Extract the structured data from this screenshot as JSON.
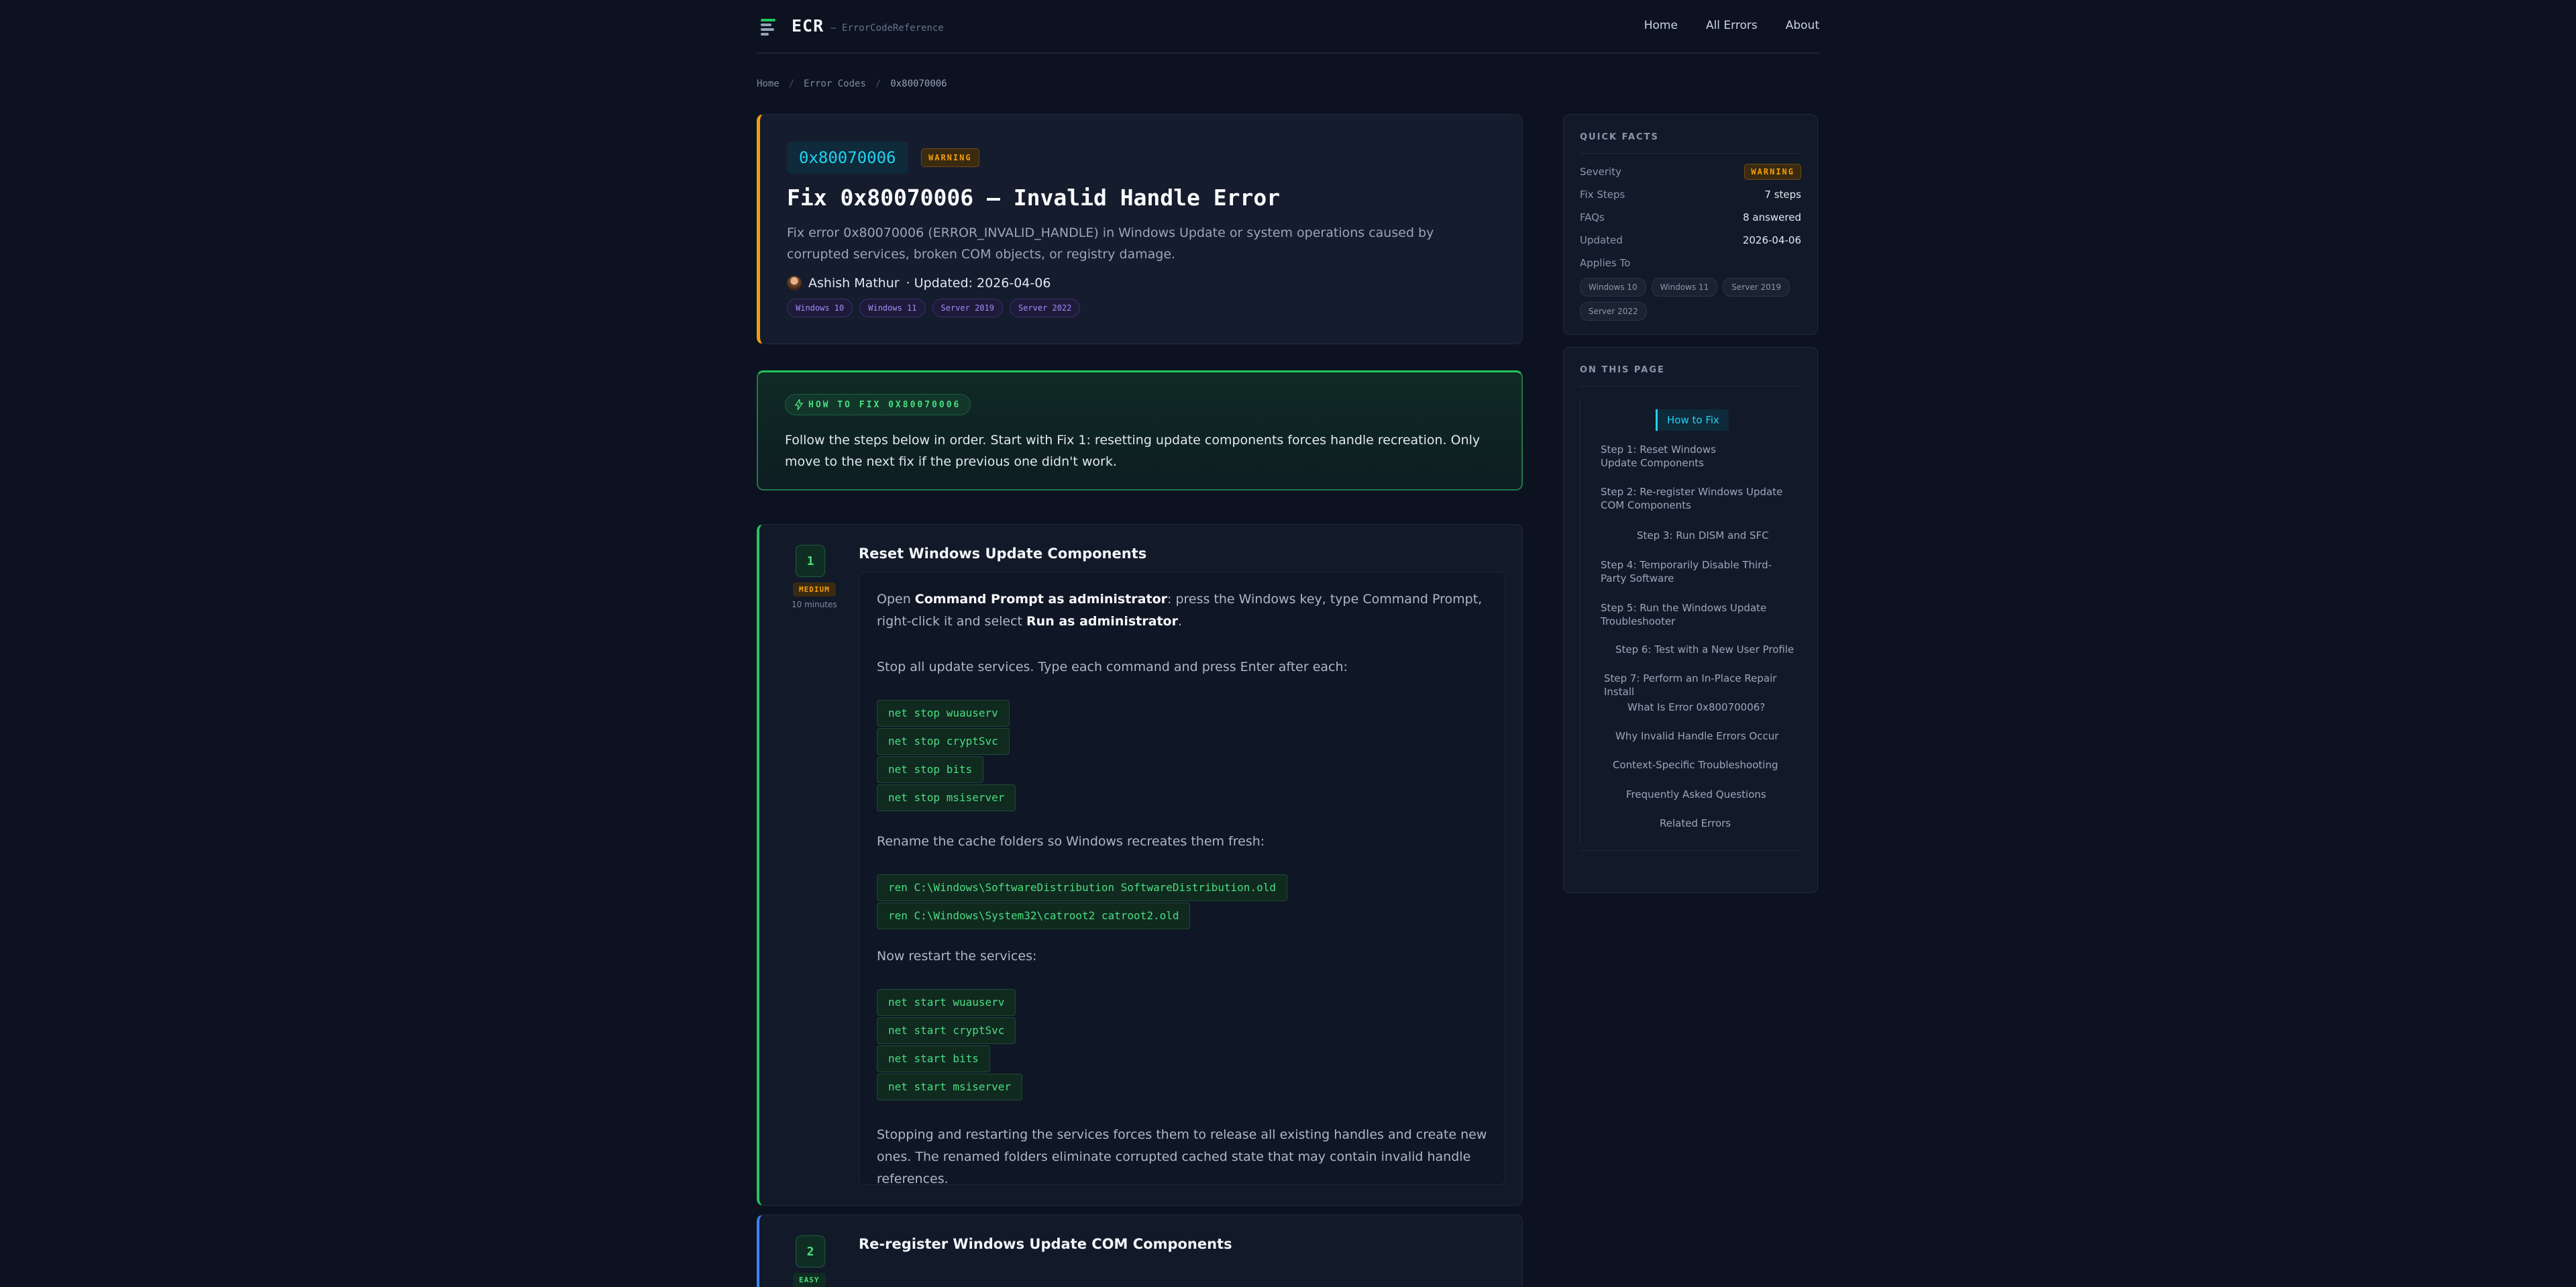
{
  "header": {
    "logo": "ECR",
    "logo_sub": "— ErrorCodeReference",
    "nav": [
      "Home",
      "All Errors",
      "About"
    ]
  },
  "breadcrumb": {
    "items": [
      "Home",
      "Error Codes",
      "0x80070006"
    ],
    "separator": "/"
  },
  "hero": {
    "code": "0x80070006",
    "severity": "WARNING",
    "title": "Fix 0x80070006 — Invalid Handle Error",
    "description": "Fix error 0x80070006 (ERROR_INVALID_HANDLE) in Windows Update or system operations caused by corrupted services, broken COM objects, or registry damage.",
    "author": "Ashish Mathur",
    "updated": "· Updated: 2026-04-06",
    "tags": [
      "Windows 10",
      "Windows 11",
      "Server 2019",
      "Server 2022"
    ]
  },
  "callout": {
    "label": "HOW TO FIX 0X80070006",
    "text": "Follow the steps below in order. Start with Fix 1: resetting update components forces handle recreation. Only move to the next fix if the previous one didn't work."
  },
  "steps": [
    {
      "number": "1",
      "difficulty": "MEDIUM",
      "time": "10 minutes",
      "title": "Reset Windows Update Components",
      "p1_a": "Open ",
      "p1_b": "Command Prompt as administrator",
      "p1_c": ": press the Windows key, type Command Prompt, right-click it and select ",
      "p1_d": "Run as administrator",
      "p1_e": ".",
      "p2": "Stop all update services. Type each command and press Enter after each:",
      "cmds1": [
        "net stop wuauserv",
        "net stop cryptSvc",
        "net stop bits",
        "net stop msiserver"
      ],
      "p3": "Rename the cache folders so Windows recreates them fresh:",
      "cmds2": [
        "ren C:\\Windows\\SoftwareDistribution SoftwareDistribution.old",
        "ren C:\\Windows\\System32\\catroot2 catroot2.old"
      ],
      "p4": "Now restart the services:",
      "cmds3": [
        "net start wuauserv",
        "net start cryptSvc",
        "net start bits",
        "net start msiserver"
      ],
      "p5": "Stopping and restarting the services forces them to release all existing handles and create new ones. The renamed folders eliminate corrupted cached state that may contain invalid handle references."
    },
    {
      "number": "2",
      "difficulty": "EASY",
      "title": "Re-register Windows Update COM Components"
    }
  ],
  "quick_facts": {
    "heading": "QUICK FACTS",
    "severity_label": "Severity",
    "severity_value": "WARNING",
    "fix_steps_label": "Fix Steps",
    "fix_steps_value": "7 steps",
    "faqs_label": "FAQs",
    "faqs_value": "8 answered",
    "updated_label": "Updated",
    "updated_value": "2026-04-06",
    "applies_label": "Applies To",
    "applies": [
      "Windows 10",
      "Windows 11",
      "Server 2019",
      "Server 2022"
    ]
  },
  "toc": {
    "heading": "ON THIS PAGE",
    "items": [
      "How to Fix",
      "Step 1: Reset Windows Update Components",
      "Step 2: Re-register Windows Update COM Components",
      "Step 3: Run DISM and SFC",
      "Step 4: Temporarily Disable Third-Party Software",
      "Step 5: Run the Windows Update Troubleshooter",
      "Step 6: Test with a New User Profile",
      "Step 7: Perform an In-Place Repair Install",
      "What Is Error 0x80070006?",
      "Why Invalid Handle Errors Occur",
      "Context-Specific Troubleshooting",
      "Frequently Asked Questions",
      "Related Errors"
    ]
  },
  "colors": {
    "background": "#0c1220",
    "warning": "#f59e0b",
    "success": "#22c55e",
    "accent": "#22d3ee",
    "step2_accent": "#3b82f6"
  }
}
